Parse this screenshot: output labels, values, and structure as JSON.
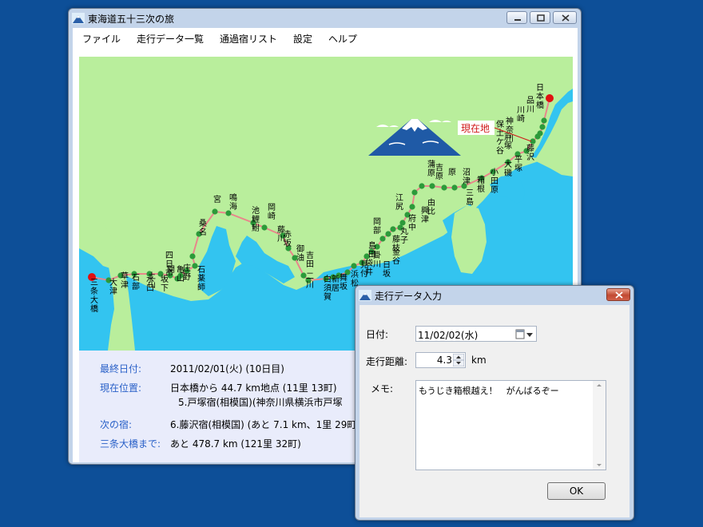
{
  "main": {
    "title": "東海道五十三次の旅",
    "menu": [
      "ファイル",
      "走行データ一覧",
      "通過宿リスト",
      "設定",
      "ヘルプ"
    ],
    "info": {
      "last_date_label": "最終日付:",
      "last_date_value": "2011/02/01(火) (10日目)",
      "position_label": "現在位置:",
      "position_line1": "日本橋から 44.7 km地点 (11里 13町)",
      "position_line2": "5.戸塚宿(相模国)(神奈川県横浜市戸塚",
      "next_label": "次の宿:",
      "next_value": "6.藤沢宿(相模国) (あと 7.1 km、1里 29町)",
      "remain_label": "三条大橋まで:",
      "remain_value": "あと 478.7 km (121里 32町)"
    }
  },
  "map": {
    "current_label": "現在地",
    "route_color": "#e8878b",
    "station_color": "#2c9a3a",
    "endpoint_color": "#e01010",
    "stations": [
      "日本橋",
      "品川",
      "川崎",
      "神奈川",
      "保土ケ谷",
      "戸塚",
      "藤沢",
      "平塚",
      "大磯",
      "小田原",
      "箱根",
      "三島",
      "沼津",
      "原",
      "吉原",
      "蒲原",
      "由比",
      "興津",
      "江尻",
      "府中",
      "丸子",
      "岡部",
      "藤枝",
      "島田",
      "金谷",
      "日坂",
      "掛川",
      "袋井",
      "見付",
      "浜松",
      "舞坂",
      "新居",
      "白須賀",
      "二川",
      "吉田",
      "御油",
      "赤坂",
      "藤川",
      "岡崎",
      "池鯉鮒",
      "鳴海",
      "宮",
      "桑名",
      "四日市",
      "石薬師",
      "庄野",
      "亀山",
      "関",
      "坂下",
      "土山",
      "水口",
      "石部",
      "草津",
      "大津",
      "三条大橋"
    ]
  },
  "dialog": {
    "title": "走行データ入力",
    "date_label": "日付:",
    "date_value": "11/02/02(水)",
    "distance_label": "走行距離:",
    "distance_value": "4.3",
    "distance_unit": "km",
    "memo_label": "メモ:",
    "memo_value": "もうじき箱根越え！　がんばるぞー",
    "ok_label": "OK"
  }
}
